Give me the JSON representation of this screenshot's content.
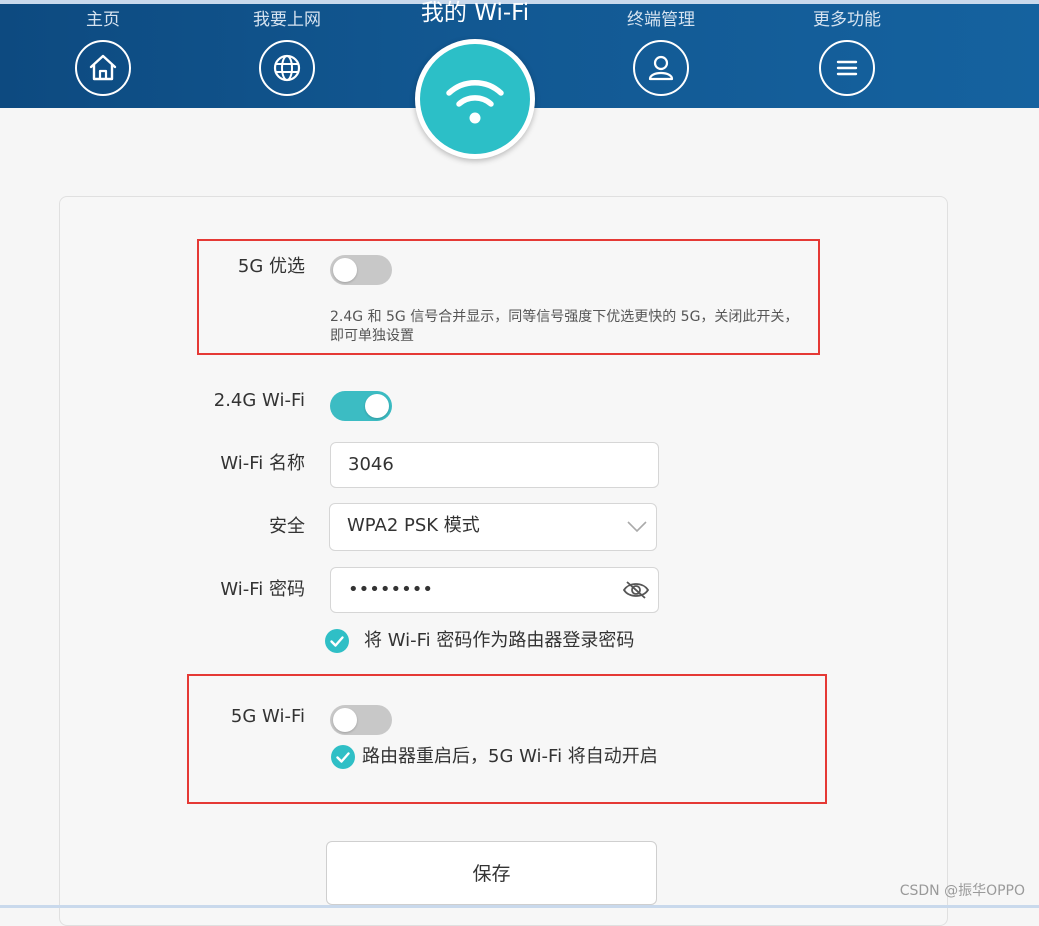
{
  "nav": {
    "items": [
      {
        "label": "主页",
        "icon": "home-icon"
      },
      {
        "label": "我要上网",
        "icon": "globe-icon"
      },
      {
        "label": "终端管理",
        "icon": "user-icon"
      },
      {
        "label": "更多功能",
        "icon": "menu-icon"
      }
    ],
    "active": {
      "label": "我的 Wi-Fi",
      "icon": "wifi-icon"
    }
  },
  "settings": {
    "band_steering": {
      "label": "5G 优选",
      "enabled": false,
      "hint": "2.4G 和 5G 信号合并显示，同等信号强度下优选更快的 5G，关闭此开关，即可单独设置"
    },
    "wifi_24g": {
      "label": "2.4G Wi-Fi",
      "enabled": true
    },
    "ssid": {
      "label": "Wi-Fi 名称",
      "value": "3046"
    },
    "security": {
      "label": "安全",
      "value": "WPA2 PSK 模式"
    },
    "password": {
      "label": "Wi-Fi 密码",
      "value": "••••••••"
    },
    "use_as_admin_password": {
      "label": "将 Wi-Fi 密码作为路由器登录密码",
      "checked": true
    },
    "wifi_5g": {
      "label": "5G Wi-Fi",
      "enabled": false
    },
    "auto_enable_5g": {
      "label": "路由器重启后，5G Wi-Fi 将自动开启",
      "checked": true
    }
  },
  "actions": {
    "save_label": "保存"
  },
  "watermark": "CSDN @振华OPPO",
  "colors": {
    "header": "#125892",
    "accent": "#2cbfc7",
    "highlight_box": "#e53935"
  }
}
